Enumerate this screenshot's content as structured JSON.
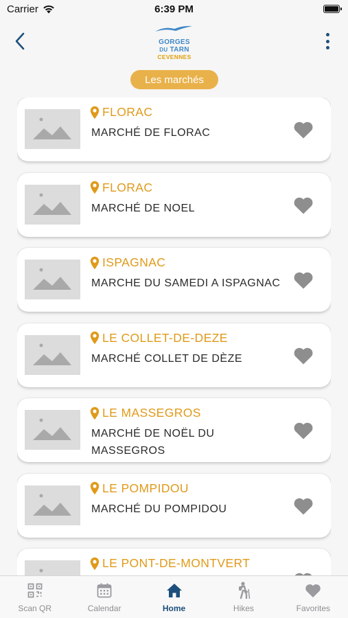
{
  "status_bar": {
    "carrier": "Carrier",
    "time": "6:39 PM"
  },
  "header": {
    "logo": {
      "line1": "GORGES",
      "line2_small": "DU",
      "line2": "TARN",
      "line3": "CEVENNES"
    },
    "section_pill": "Les marchés"
  },
  "markets": [
    {
      "town": "FLORAC",
      "name": "MARCHÉ DE FLORAC"
    },
    {
      "town": "FLORAC",
      "name": "MARCHÉ DE NOEL"
    },
    {
      "town": "ISPAGNAC",
      "name": "MARCHE DU SAMEDI A ISPAGNAC"
    },
    {
      "town": "LE COLLET-DE-DEZE",
      "name": "MARCHÉ COLLET DE DÈZE"
    },
    {
      "town": "LE MASSEGROS",
      "name": "MARCHÉ DE NOËL DU MASSEGROS"
    },
    {
      "town": "LE POMPIDOU",
      "name": "MARCHÉ DU POMPIDOU"
    },
    {
      "town": "LE PONT-DE-MONTVERT",
      "name": ""
    }
  ],
  "tabs": [
    {
      "label": "Scan QR",
      "icon": "qr-code-icon",
      "active": false
    },
    {
      "label": "Calendar",
      "icon": "calendar-icon",
      "active": false
    },
    {
      "label": "Home",
      "icon": "home-icon",
      "active": true
    },
    {
      "label": "Hikes",
      "icon": "hiker-icon",
      "active": false
    },
    {
      "label": "Favorites",
      "icon": "heart-icon",
      "active": false
    }
  ],
  "colors": {
    "accent": "#e09a1a",
    "pill": "#e9b14a",
    "brand_blue": "#1d4f7c",
    "logo_blue": "#3d88c8"
  }
}
